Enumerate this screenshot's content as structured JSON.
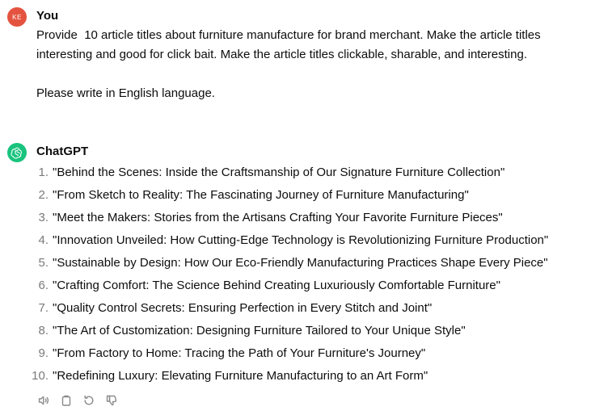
{
  "user_message": {
    "avatar_initials": "KE",
    "avatar_color": "#e4533f",
    "author": "You",
    "paragraphs": [
      "Provide  10 article titles about furniture manufacture for brand merchant. Make the article titles interesting and good for click bait. Make the article titles clickable, sharable, and interesting.",
      "Please write in English language."
    ]
  },
  "assistant_message": {
    "avatar_icon": "openai-logo-icon",
    "avatar_color": "#19c37d",
    "author": "ChatGPT",
    "titles": [
      {
        "num": "1.",
        "text": "\"Behind the Scenes: Inside the Craftsmanship of Our Signature Furniture Collection\""
      },
      {
        "num": "2.",
        "text": "\"From Sketch to Reality: The Fascinating Journey of Furniture Manufacturing\""
      },
      {
        "num": "3.",
        "text": "\"Meet the Makers: Stories from the Artisans Crafting Your Favorite Furniture Pieces\""
      },
      {
        "num": "4.",
        "text": "\"Innovation Unveiled: How Cutting-Edge Technology is Revolutionizing Furniture Production\""
      },
      {
        "num": "5.",
        "text": "\"Sustainable by Design: How Our Eco-Friendly Manufacturing Practices Shape Every Piece\""
      },
      {
        "num": "6.",
        "text": "\"Crafting Comfort: The Science Behind Creating Luxuriously Comfortable Furniture\""
      },
      {
        "num": "7.",
        "text": "\"Quality Control Secrets: Ensuring Perfection in Every Stitch and Joint\""
      },
      {
        "num": "8.",
        "text": "\"The Art of Customization: Designing Furniture Tailored to Your Unique Style\""
      },
      {
        "num": "9.",
        "text": "\"From Factory to Home: Tracing the Path of Your Furniture's Journey\""
      },
      {
        "num": "10.",
        "text": "\"Redefining Luxury: Elevating Furniture Manufacturing to an Art Form\""
      }
    ],
    "actions": [
      {
        "icon": "read-aloud-icon"
      },
      {
        "icon": "copy-icon"
      },
      {
        "icon": "regenerate-icon"
      },
      {
        "icon": "thumbs-down-icon"
      }
    ]
  }
}
